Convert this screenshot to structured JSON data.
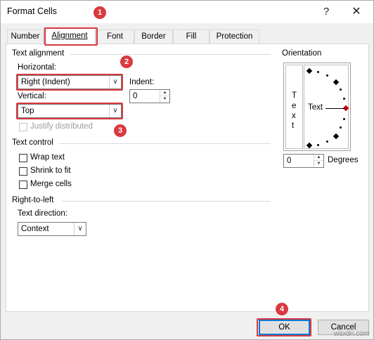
{
  "window": {
    "title": "Format Cells",
    "help": "?",
    "close": "✕"
  },
  "tabs": [
    {
      "label": "Number"
    },
    {
      "label": "Alignment",
      "active": true
    },
    {
      "label": "Font"
    },
    {
      "label": "Border"
    },
    {
      "label": "Fill"
    },
    {
      "label": "Protection"
    }
  ],
  "text_alignment": {
    "title": "Text alignment",
    "horizontal_label": "Horizontal:",
    "horizontal_value": "Right (Indent)",
    "indent_label": "Indent:",
    "indent_value": "0",
    "vertical_label": "Vertical:",
    "vertical_value": "Top",
    "justify_distributed": "Justify distributed"
  },
  "text_control": {
    "title": "Text control",
    "wrap_text": "Wrap text",
    "shrink_to_fit": "Shrink to fit",
    "merge_cells": "Merge cells"
  },
  "rtl": {
    "title": "Right-to-left",
    "direction_label": "Text direction:",
    "direction_value": "Context"
  },
  "orientation": {
    "title": "Orientation",
    "vertical_letters": [
      "T",
      "e",
      "x",
      "t"
    ],
    "dial_label": "Text",
    "degrees_value": "0",
    "degrees_label": "Degrees"
  },
  "buttons": {
    "ok": "OK",
    "cancel": "Cancel"
  },
  "callouts": [
    "1",
    "2",
    "3",
    "4"
  ],
  "watermark": "wsxdn.com",
  "colors": {
    "highlight": "#d9393f",
    "focus": "#0078d7"
  }
}
